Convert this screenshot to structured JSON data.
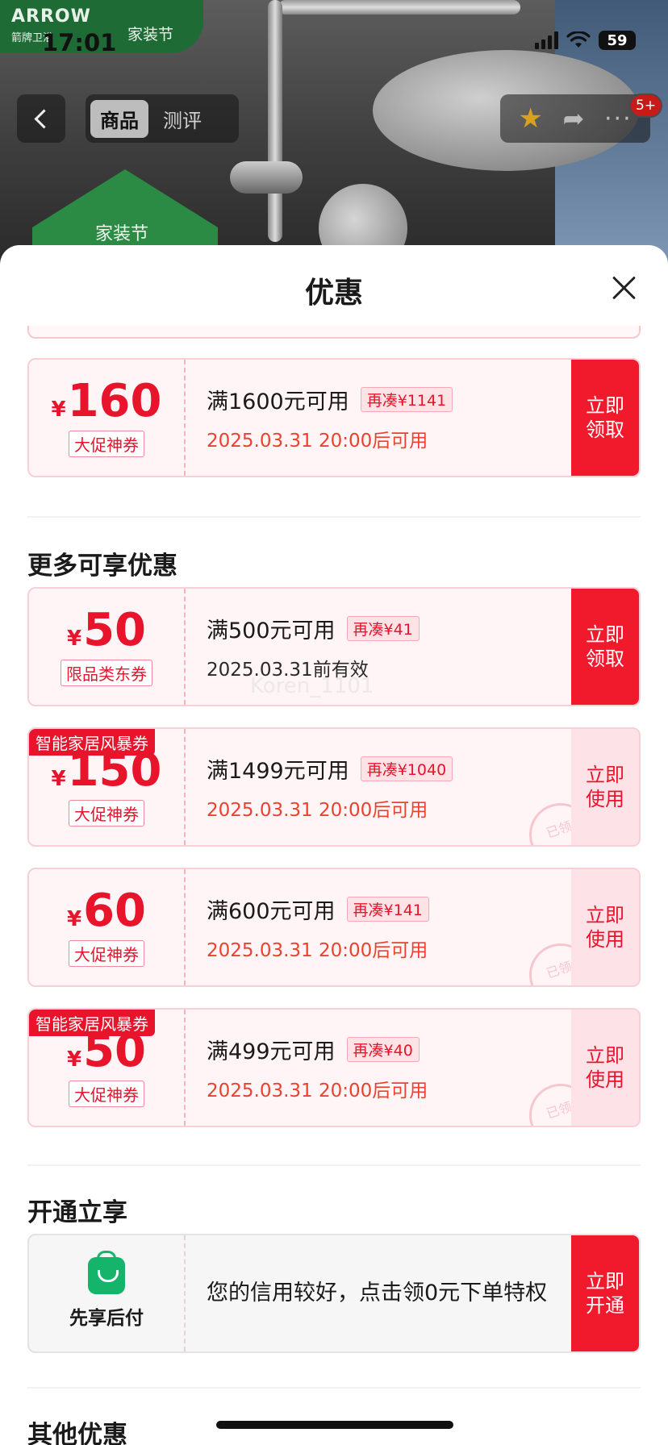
{
  "status_bar": {
    "time": "17:01",
    "battery": "59"
  },
  "hero": {
    "brand": "ARROW",
    "brand_sub": "箭牌卫浴",
    "festival": "家装节",
    "badge_text": "家装节"
  },
  "nav": {
    "tabs": [
      {
        "label": "商品",
        "active": true
      },
      {
        "label": "测评",
        "active": false
      }
    ],
    "message_badge": "5+"
  },
  "sheet": {
    "title": "优惠"
  },
  "watermark": "Koren_1101",
  "coupons_top": [
    {
      "currency": "¥",
      "amount": "160",
      "type": "大促神券",
      "condition": "满1600元可用",
      "needs": "再凑¥1141",
      "validity": "2025.03.31 20:00后可用",
      "action": "立即领取"
    }
  ],
  "section_more": {
    "title": "更多可享优惠"
  },
  "coupons_more": [
    {
      "currency": "¥",
      "amount": "50",
      "type": "限品类东券",
      "corner": "",
      "condition": "满500元可用",
      "needs": "再凑¥41",
      "validity": "2025.03.31前有效",
      "action": "立即领取",
      "stamp": ""
    },
    {
      "currency": "¥",
      "amount": "150",
      "type": "大促神券",
      "corner": "智能家居风暴券",
      "condition": "满1499元可用",
      "needs": "再凑¥1040",
      "validity": "2025.03.31 20:00后可用",
      "action": "立即使用",
      "stamp": "已领"
    },
    {
      "currency": "¥",
      "amount": "60",
      "type": "大促神券",
      "corner": "",
      "condition": "满600元可用",
      "needs": "再凑¥141",
      "validity": "2025.03.31 20:00后可用",
      "action": "立即使用",
      "stamp": "已领"
    },
    {
      "currency": "¥",
      "amount": "50",
      "type": "大促神券",
      "corner": "智能家居风暴券",
      "condition": "满499元可用",
      "needs": "再凑¥40",
      "validity": "2025.03.31 20:00后可用",
      "action": "立即使用",
      "stamp": "已领"
    }
  ],
  "section_open": {
    "title": "开通立享"
  },
  "credit": {
    "label": "先享后付",
    "description": "您的信用较好，点击领0元下单特权",
    "action": "立即开通"
  },
  "section_other": {
    "title": "其他优惠"
  },
  "colors": {
    "accent": "#f01a2c",
    "price": "#e8142b",
    "credit_green": "#14b56a"
  }
}
